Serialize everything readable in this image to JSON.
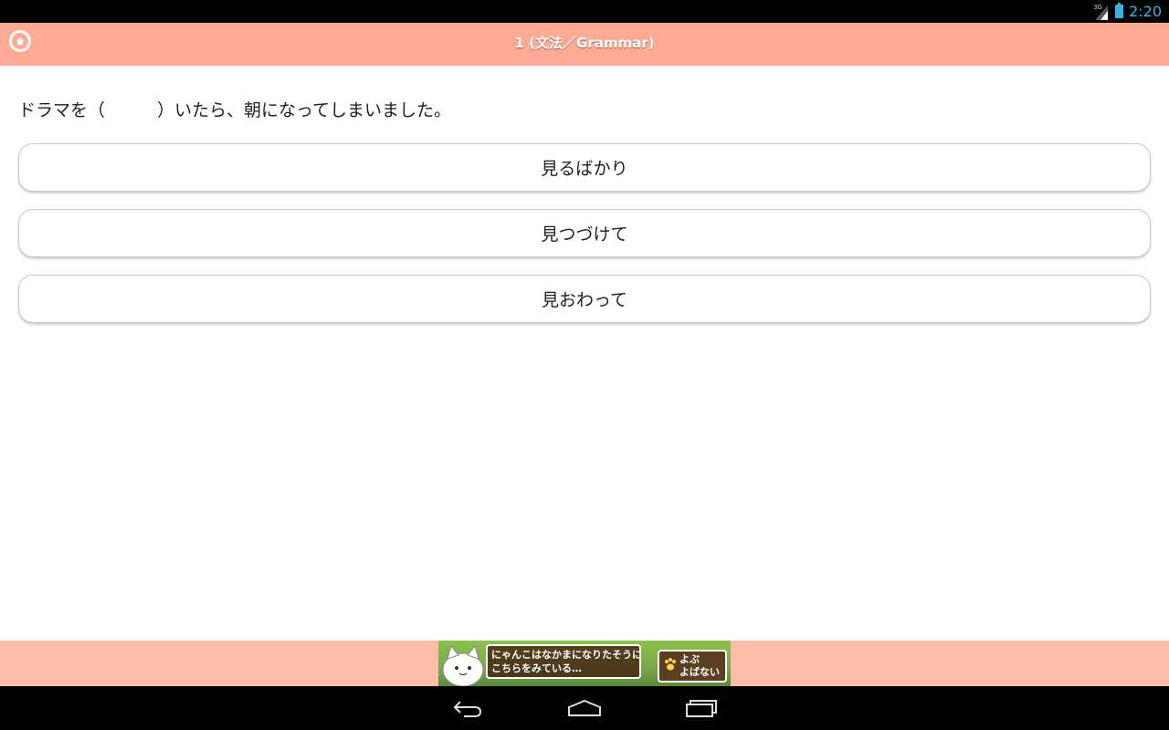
{
  "status_bar": {
    "network_type": "3G",
    "time": "2:20"
  },
  "header": {
    "title": "1 (文法／Grammar)",
    "home_icon": "home-icon",
    "background": "#ffab94"
  },
  "question": {
    "text": "ドラマを（　　　）いたら、朝になってしまいました。"
  },
  "options": [
    {
      "label": "見るばかり"
    },
    {
      "label": "見つづけて"
    },
    {
      "label": "見おわって"
    }
  ],
  "ad": {
    "line1": "にゃんこはなかまになりたそうに",
    "line2": "こちらをみている…",
    "button_line1": "よぶ",
    "button_line2": "よばない"
  },
  "nav_bar": {
    "icons": [
      "back-icon",
      "home-icon",
      "recent-apps-icon"
    ]
  }
}
